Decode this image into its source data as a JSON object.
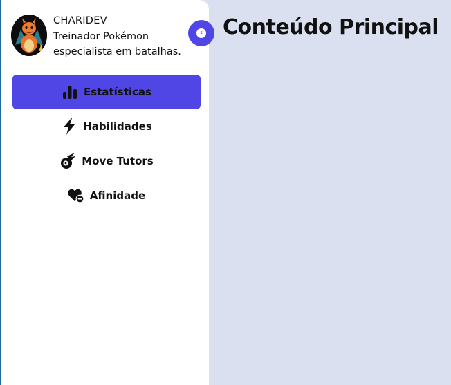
{
  "profile": {
    "name": "CHARIDEV",
    "bio": "Treinador Pokémon especialista em batalhas."
  },
  "sidebar": {
    "collapse_icon": "chevron-left-icon",
    "items": [
      {
        "label": "Estatísticas",
        "icon": "bar-chart-icon",
        "active": true
      },
      {
        "label": "Habilidades",
        "icon": "lightning-bolt-icon",
        "active": false
      },
      {
        "label": "Move Tutors",
        "icon": "comet-icon",
        "active": false
      },
      {
        "label": "Afinidade",
        "icon": "heart-minus-icon",
        "active": false
      }
    ]
  },
  "main": {
    "title": "Conteúdo Principal"
  },
  "colors": {
    "accent": "#4f46e5",
    "main_background": "#dbe0f0",
    "sidebar_background": "#ffffff"
  }
}
